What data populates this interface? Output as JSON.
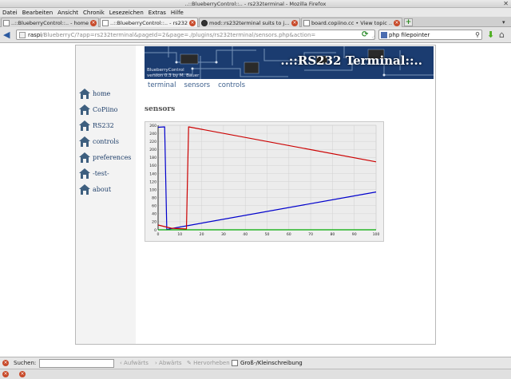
{
  "window": {
    "title": "..::BlueberryControl::.. - rs232terminal - Mozilla Firefox"
  },
  "menu": [
    "Datei",
    "Bearbeiten",
    "Ansicht",
    "Chronik",
    "Lesezeichen",
    "Extras",
    "Hilfe"
  ],
  "tabs": [
    {
      "label": "..::BlueberryControl::.. - home",
      "active": false
    },
    {
      "label": "..::BlueberryControl::.. - rs232...",
      "active": true
    },
    {
      "label": "mod::rs232terminal suits to j...",
      "active": false
    },
    {
      "label": "board.copiino.cc • View topic ...",
      "active": false
    }
  ],
  "address": {
    "host": "raspi",
    "path": "/BlueberryC/?app=rs232terminal&pageId=2&page=./plugins/rs232terminal/sensors.php&action="
  },
  "search": {
    "value": "php filepointer"
  },
  "banner": {
    "title": "..::RS232 Terminal::..",
    "subtitle_line1": "BlueberryControl",
    "subtitle_line2": "version 0.3 by M. Bauer"
  },
  "sidebar": [
    {
      "label": "home"
    },
    {
      "label": "CoPiino"
    },
    {
      "label": "RS232"
    },
    {
      "label": "controls"
    },
    {
      "label": "preferences"
    },
    {
      "label": "-test-"
    },
    {
      "label": "about"
    }
  ],
  "topnav": [
    "terminal",
    "sensors",
    "controls"
  ],
  "section_title": "sensors",
  "findbar": {
    "label": "Suchen:",
    "up": "Aufwärts",
    "down": "Abwärts",
    "highlight": "Hervorheben",
    "match_case": "Groß-/Kleinschreibung"
  },
  "chart_data": {
    "type": "line",
    "xlim": [
      0,
      100
    ],
    "ylim": [
      0,
      260
    ],
    "x_ticks": [
      0,
      10,
      20,
      30,
      40,
      50,
      60,
      70,
      80,
      90,
      100
    ],
    "y_ticks": [
      0,
      20,
      40,
      60,
      80,
      100,
      120,
      140,
      160,
      180,
      200,
      220,
      240,
      260
    ],
    "grid": true,
    "series": [
      {
        "color": "#0000cc",
        "points": [
          [
            0,
            255
          ],
          [
            3,
            256
          ],
          [
            4,
            0
          ],
          [
            5,
            2
          ],
          [
            100,
            94
          ]
        ]
      },
      {
        "color": "#cc0000",
        "points": [
          [
            0,
            12
          ],
          [
            6,
            4
          ],
          [
            13,
            2
          ],
          [
            14,
            256
          ],
          [
            100,
            169
          ]
        ]
      },
      {
        "color": "#00aa00",
        "points": [
          [
            0,
            0
          ],
          [
            100,
            0
          ]
        ]
      }
    ]
  }
}
